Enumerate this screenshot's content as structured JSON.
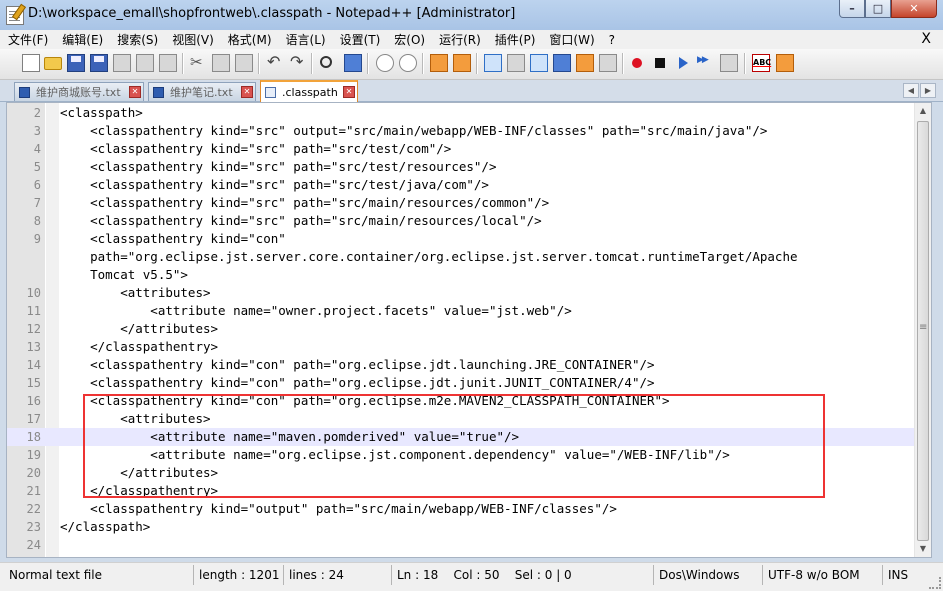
{
  "window": {
    "title": "D:\\workspace_emall\\shopfrontweb\\.classpath - Notepad++ [Administrator]",
    "min_label": "–",
    "max_label": "□",
    "close_label": "✕"
  },
  "menubar": {
    "items": [
      "文件(F)",
      "编辑(E)",
      "搜索(S)",
      "视图(V)",
      "格式(M)",
      "语言(L)",
      "设置(T)",
      "宏(O)",
      "运行(R)",
      "插件(P)",
      "窗口(W)",
      "?"
    ],
    "close_doc": "X"
  },
  "toolbar": {
    "icons": [
      "new-file-icon",
      "open-file-icon",
      "save-icon",
      "save-all-icon",
      "close-icon",
      "close-all-icon",
      "print-icon",
      "cut-icon",
      "copy-icon",
      "paste-icon",
      "undo-icon",
      "redo-icon",
      "find-icon",
      "replace-icon",
      "zoom-in-icon",
      "zoom-out-icon",
      "sync-vertical-icon",
      "sync-horizontal-icon",
      "word-wrap-icon",
      "show-all-chars-icon",
      "indent-guide-icon",
      "user-lang-icon",
      "doc-map-icon",
      "function-list-icon",
      "record-macro-icon",
      "stop-record-icon",
      "play-macro-icon",
      "run-macro-multiple-icon",
      "save-macro-icon",
      "spellcheck-icon",
      "html-tag-icon"
    ]
  },
  "tabs": [
    {
      "label": "维护商城账号.txt",
      "active": false
    },
    {
      "label": "维护笔记.txt",
      "active": false
    },
    {
      "label": ".classpath",
      "active": true
    }
  ],
  "editor": {
    "lines": [
      {
        "n": "2",
        "text": "<classpath>"
      },
      {
        "n": "3",
        "text": "    <classpathentry kind=\"src\" output=\"src/main/webapp/WEB-INF/classes\" path=\"src/main/java\"/>"
      },
      {
        "n": "4",
        "text": "    <classpathentry kind=\"src\" path=\"src/test/com\"/>"
      },
      {
        "n": "5",
        "text": "    <classpathentry kind=\"src\" path=\"src/test/resources\"/>"
      },
      {
        "n": "6",
        "text": "    <classpathentry kind=\"src\" path=\"src/test/java/com\"/>"
      },
      {
        "n": "7",
        "text": "    <classpathentry kind=\"src\" path=\"src/main/resources/common\"/>"
      },
      {
        "n": "8",
        "text": "    <classpathentry kind=\"src\" path=\"src/main/resources/local\"/>"
      },
      {
        "n": "9",
        "text": "    <classpathentry kind=\"con\""
      },
      {
        "n": "",
        "text": "    path=\"org.eclipse.jst.server.core.container/org.eclipse.jst.server.tomcat.runtimeTarget/Apache"
      },
      {
        "n": "",
        "text": "    Tomcat v5.5\">"
      },
      {
        "n": "10",
        "text": "        <attributes>"
      },
      {
        "n": "11",
        "text": "            <attribute name=\"owner.project.facets\" value=\"jst.web\"/>"
      },
      {
        "n": "12",
        "text": "        </attributes>"
      },
      {
        "n": "13",
        "text": "    </classpathentry>"
      },
      {
        "n": "14",
        "text": "    <classpathentry kind=\"con\" path=\"org.eclipse.jdt.launching.JRE_CONTAINER\"/>"
      },
      {
        "n": "15",
        "text": "    <classpathentry kind=\"con\" path=\"org.eclipse.jdt.junit.JUNIT_CONTAINER/4\"/>"
      },
      {
        "n": "16",
        "text": "    <classpathentry kind=\"con\" path=\"org.eclipse.m2e.MAVEN2_CLASSPATH_CONTAINER\">"
      },
      {
        "n": "17",
        "text": "        <attributes>"
      },
      {
        "n": "18",
        "text": "            <attribute name=\"maven.pomderived\" value=\"true\"/>",
        "current": true
      },
      {
        "n": "19",
        "text": "            <attribute name=\"org.eclipse.jst.component.dependency\" value=\"/WEB-INF/lib\"/>"
      },
      {
        "n": "20",
        "text": "        </attributes>"
      },
      {
        "n": "21",
        "text": "    </classpathentry>"
      },
      {
        "n": "22",
        "text": "    <classpathentry kind=\"output\" path=\"src/main/webapp/WEB-INF/classes\"/>"
      },
      {
        "n": "23",
        "text": "</classpath>"
      },
      {
        "n": "24",
        "text": ""
      }
    ]
  },
  "statusbar": {
    "file_type": "Normal text file",
    "length": "length : 1201",
    "lines": "lines : 24",
    "position": "Ln : 18    Col : 50    Sel : 0 | 0",
    "eol": "Dos\\Windows",
    "encoding": "UTF-8 w/o BOM",
    "mode": "INS"
  },
  "colors": {
    "highlight_box": "#e33333",
    "current_line": "#e8e8ff"
  }
}
